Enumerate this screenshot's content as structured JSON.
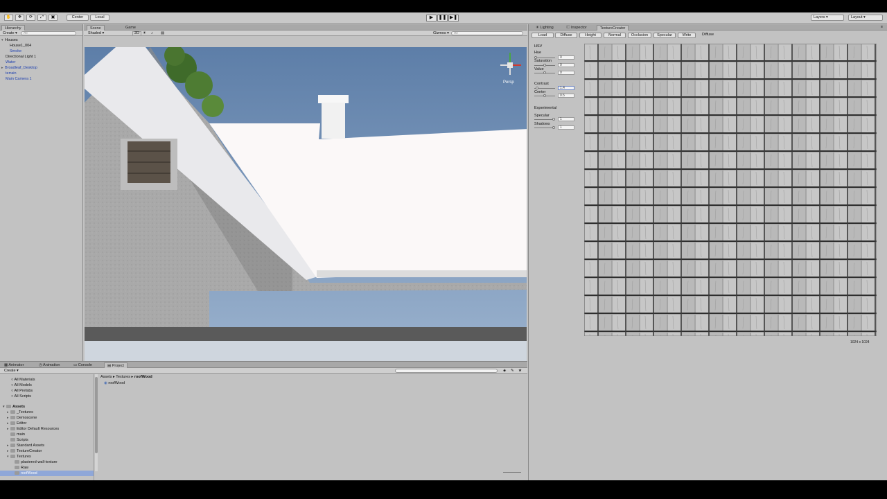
{
  "toolbar": {
    "pivot_center": "Center",
    "pivot_local": "Local",
    "layers": "Layers",
    "layout": "Layout"
  },
  "hierarchy": {
    "tab": "Hierarchy",
    "create": "Create",
    "search_placeholder": "All",
    "items": [
      "Houses",
      "House1_004",
      "Smoke",
      "Directional Light 1",
      "Water",
      "Broadleaf_Desktop",
      "terrain",
      "Main Camera 1"
    ]
  },
  "scene": {
    "tab_scene": "Scene",
    "tab_game": "Game",
    "shading": "Shaded",
    "mode_2d": "2D",
    "gizmos": "Gizmos",
    "gizmos_search": "All",
    "persp": "Persp"
  },
  "right_panel": {
    "tab_lighting": "Lighting",
    "tab_inspector": "Inspector",
    "tab_texture_creator": "TextureCreator",
    "buttons": [
      "Load",
      "Diffuse",
      "Height",
      "Normal",
      "Occlusion",
      "Specular",
      "Write"
    ],
    "mode_label": "Diffuse",
    "hsv_section": "HSV",
    "hue_label": "Hue",
    "hue_value": "0",
    "saturation_label": "Saturation",
    "saturation_value": "0",
    "value_label": "Value",
    "value_value": "0",
    "contrast_label": "Contrast",
    "contrast_value": "1.4",
    "center_label": "Center",
    "center_value": "0.5",
    "experimental_section": "Experimental",
    "specular_label": "Specular",
    "specular_value": "1",
    "shadows_label": "Shadows",
    "shadows_value": "1",
    "resolution": "1024 x 1024"
  },
  "bottom": {
    "tab_animator": "Animator",
    "tab_animation": "Animation",
    "tab_console": "Console",
    "tab_project": "Project",
    "create": "Create",
    "favorites": [
      "All Materials",
      "All Models",
      "All Prefabs",
      "All Scripts"
    ],
    "assets_root": "Assets",
    "folders": [
      "_Textures",
      "Demoscene",
      "Editor",
      "Editor Default Resources",
      "main",
      "Scripts",
      "Standard Assets",
      "TextureCreator",
      "Textures"
    ],
    "textures_children": [
      "plastered-wall-texture",
      "Raw",
      "roofWood"
    ],
    "breadcrumb": [
      "Assets",
      "Textures",
      "roofWood"
    ],
    "file": "roofWood"
  }
}
